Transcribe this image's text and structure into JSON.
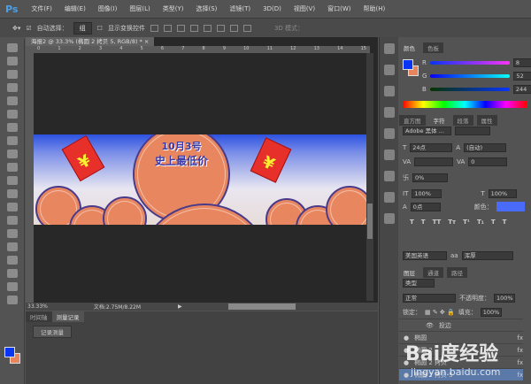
{
  "app": {
    "logo": "Ps"
  },
  "menu": [
    "文件(F)",
    "编辑(E)",
    "图像(I)",
    "图层(L)",
    "类型(Y)",
    "选择(S)",
    "滤镜(T)",
    "3D(D)",
    "视图(V)",
    "窗口(W)",
    "帮助(H)"
  ],
  "options": {
    "auto_select_label": "自动选择：",
    "auto_select_value": "组",
    "show_transform_label": "显示变换控件",
    "mode_3d": "3D 模式："
  },
  "document": {
    "tab": "海报2 @ 33.3% (椭圆 2 拷贝 5, RGB/8) *",
    "ruler": [
      "0",
      "1",
      "2",
      "3",
      "4",
      "5",
      "6",
      "7",
      "8",
      "9",
      "10",
      "11",
      "12",
      "13",
      "14",
      "15"
    ],
    "headline_1": "10月3号",
    "headline_2": "史上最低价",
    "yuan": "¥"
  },
  "status": {
    "zoom": "33.33%",
    "doc_size": "文档:2.75M/8.22M"
  },
  "history_panel": {
    "tabs": [
      "时间轴",
      "测量记录"
    ],
    "record_button": "记录测量"
  },
  "color_panel": {
    "tabs": [
      "颜色",
      "色板"
    ],
    "r_label": "R",
    "g_label": "G",
    "b_label": "B",
    "r": "8",
    "g": "52",
    "b": "244",
    "foreground": "#0834f4",
    "background": "#e8845c"
  },
  "char_panel": {
    "tabs": [
      "直方图",
      "字符",
      "段落",
      "属性"
    ],
    "font": "Adobe 黑体 ...",
    "size": "24点",
    "leading": "(自动)",
    "tracking": "0",
    "scale": "0%",
    "vscale": "100%",
    "hscale": "100%",
    "baseline": "0点",
    "color_label": "颜色：",
    "color": "#4a6af8",
    "language": "美国英语",
    "aa_label": "aa",
    "aa": "浑厚"
  },
  "layers_panel": {
    "tabs": [
      "图层",
      "通道",
      "路径"
    ],
    "filter": "类型",
    "blend": "正常",
    "opacity_label": "不透明度：",
    "opacity": "100%",
    "lock_label": "锁定：",
    "fill_label": "填充：",
    "fill": "100%",
    "group": "投边",
    "layers": [
      "椭圆",
      "椭圆 2",
      "椭圆 2 拷贝",
      "椭圆 2 拷贝 5"
    ],
    "fx": "fx"
  },
  "watermark": {
    "text": "Bai度经验",
    "url": "jingyan.baidu.com"
  }
}
